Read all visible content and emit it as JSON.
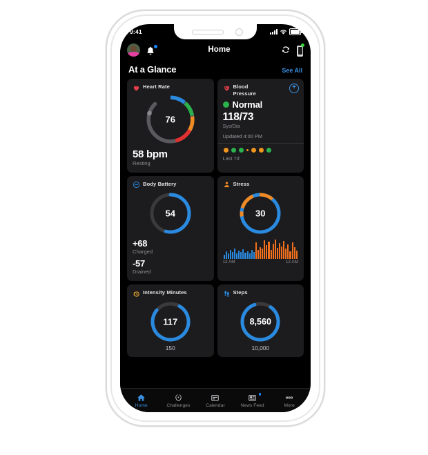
{
  "status_bar": {
    "time": "9:41",
    "signal_icon": "cellular-signal-icon",
    "wifi_icon": "wifi-icon",
    "battery_icon": "battery-icon"
  },
  "app_bar": {
    "avatar": "user-avatar",
    "notifications_icon": "bell-icon",
    "has_notification_badge": true,
    "title": "Home",
    "sync_icon": "sync-icon",
    "device_icon": "device-battery-icon",
    "device_status_color": "#35d93b"
  },
  "section": {
    "title": "At a Glance",
    "see_all": "See All"
  },
  "colors": {
    "accent": "#3a8fe0",
    "ring_blue": "#2a8ae0",
    "track": "#3a3a3c",
    "orange": "#f08a24",
    "green": "#2bb24c",
    "red": "#e03030",
    "card_bg": "#1c1c1e"
  },
  "cards": {
    "heart_rate": {
      "title": "Heart Rate",
      "icon": "heart-icon",
      "icon_color": "#e8404a",
      "gauge_value": "76",
      "primary": "58 bpm",
      "secondary": "Resting",
      "gauge_segments": [
        {
          "name": "track",
          "color": "#5a5a5e",
          "from": 0,
          "to": 150
        },
        {
          "name": "blue",
          "color": "#2a8ae0",
          "from": 150,
          "to": 190
        },
        {
          "name": "green",
          "color": "#2bb24c",
          "from": 190,
          "to": 232
        },
        {
          "name": "orange",
          "color": "#f08a24",
          "from": 232,
          "to": 272
        },
        {
          "name": "red",
          "color": "#e03030",
          "from": 272,
          "to": 320
        }
      ],
      "marker_angle": 5
    },
    "blood_pressure": {
      "title": "Blood Pressure",
      "icon": "heart-pulse-icon",
      "icon_color": "#e8404a",
      "add_button": "+",
      "status_label": "Normal",
      "status_color": "#2bb24c",
      "reading": "118/73",
      "reading_label": "Sys/Dia",
      "updated": "Updated 4:00 PM",
      "history_label": "Last 7d",
      "history_dots": [
        {
          "color": "#f0961e",
          "size": "normal"
        },
        {
          "color": "#2bb24c",
          "size": "normal"
        },
        {
          "color": "#2bb24c",
          "size": "normal"
        },
        {
          "color": "#f0961e",
          "size": "mini"
        },
        {
          "color": "#f0961e",
          "size": "normal"
        },
        {
          "color": "#f0961e",
          "size": "normal"
        },
        {
          "color": "#2bb24c",
          "size": "normal"
        }
      ]
    },
    "body_battery": {
      "title": "Body Battery",
      "icon": "body-battery-icon",
      "icon_color": "#2a8ae0",
      "gauge_value": "54",
      "gauge_percent": 54,
      "charged_value": "+68",
      "charged_label": "Charged",
      "drained_value": "-57",
      "drained_label": "Drained"
    },
    "stress": {
      "title": "Stress",
      "icon": "person-icon",
      "icon_color": "#f08a24",
      "gauge_value": "30",
      "gauge_blue_percent": 76,
      "gauge_orange_percent": 24,
      "axis_left": "12 AM",
      "axis_right": "12 AM",
      "bar_colors": {
        "low": "#2a8ae0",
        "high": "#f0701e"
      },
      "bar_values": [
        {
          "v": 22,
          "c": "low"
        },
        {
          "v": 38,
          "c": "low"
        },
        {
          "v": 30,
          "c": "low"
        },
        {
          "v": 47,
          "c": "low"
        },
        {
          "v": 34,
          "c": "low"
        },
        {
          "v": 52,
          "c": "low"
        },
        {
          "v": 29,
          "c": "low"
        },
        {
          "v": 44,
          "c": "low"
        },
        {
          "v": 36,
          "c": "low"
        },
        {
          "v": 50,
          "c": "low"
        },
        {
          "v": 33,
          "c": "low"
        },
        {
          "v": 41,
          "c": "low"
        },
        {
          "v": 28,
          "c": "low"
        },
        {
          "v": 46,
          "c": "low"
        },
        {
          "v": 35,
          "c": "low"
        },
        {
          "v": 84,
          "c": "high"
        },
        {
          "v": 45,
          "c": "high"
        },
        {
          "v": 62,
          "c": "high"
        },
        {
          "v": 55,
          "c": "high"
        },
        {
          "v": 96,
          "c": "high"
        },
        {
          "v": 70,
          "c": "high"
        },
        {
          "v": 88,
          "c": "high"
        },
        {
          "v": 48,
          "c": "high"
        },
        {
          "v": 78,
          "c": "high"
        },
        {
          "v": 100,
          "c": "high"
        },
        {
          "v": 58,
          "c": "high"
        },
        {
          "v": 82,
          "c": "high"
        },
        {
          "v": 66,
          "c": "high"
        },
        {
          "v": 92,
          "c": "high"
        },
        {
          "v": 52,
          "c": "high"
        },
        {
          "v": 74,
          "c": "high"
        },
        {
          "v": 40,
          "c": "high"
        },
        {
          "v": 86,
          "c": "high"
        },
        {
          "v": 60,
          "c": "high"
        },
        {
          "v": 44,
          "c": "high"
        }
      ]
    },
    "intensity_minutes": {
      "title": "Intensity Minutes",
      "icon": "intensity-flame-icon",
      "icon_color": "#e0a030",
      "gauge_value": "117",
      "goal": "150",
      "gauge_percent": 78
    },
    "steps": {
      "title": "Steps",
      "icon": "footsteps-icon",
      "icon_color": "#2a8ae0",
      "gauge_value": "8,560",
      "goal": "10,000",
      "gauge_percent": 85
    }
  },
  "tab_bar": {
    "items": [
      {
        "label": "Home",
        "icon": "home-icon",
        "active": true,
        "badge": false
      },
      {
        "label": "Challenges",
        "icon": "laurel-icon",
        "active": false,
        "badge": false
      },
      {
        "label": "Calendar",
        "icon": "calendar-icon",
        "active": false,
        "badge": false
      },
      {
        "label": "News Feed",
        "icon": "news-feed-icon",
        "active": false,
        "badge": true
      },
      {
        "label": "More",
        "icon": "more-dots-icon",
        "active": false,
        "badge": false
      }
    ]
  }
}
